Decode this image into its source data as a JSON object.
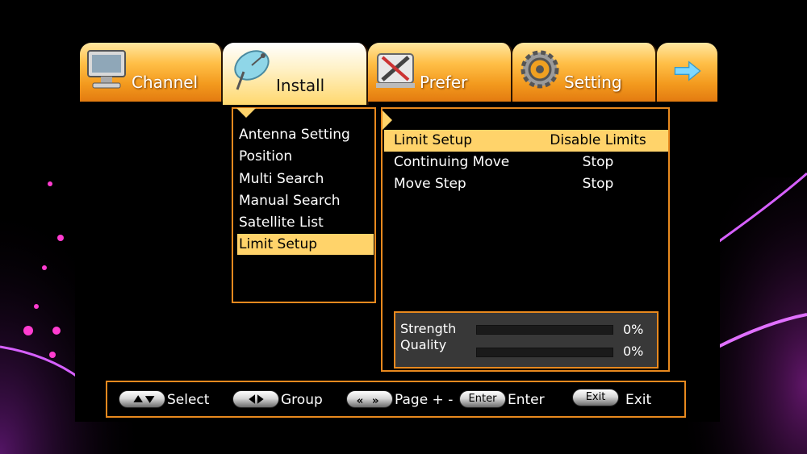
{
  "tabs": [
    {
      "label": "Channel",
      "icon": "monitor-icon"
    },
    {
      "label": "Install",
      "icon": "satellite-dish-icon",
      "active": true
    },
    {
      "label": "Prefer",
      "icon": "tools-icon"
    },
    {
      "label": "Setting",
      "icon": "gear-icon"
    },
    {
      "label": "",
      "icon": "arrow-right-icon"
    }
  ],
  "submenu": {
    "items": [
      {
        "label": "Antenna Setting"
      },
      {
        "label": "Position"
      },
      {
        "label": "Multi Search"
      },
      {
        "label": "Manual Search"
      },
      {
        "label": "Satellite List"
      },
      {
        "label": "Limit Setup",
        "selected": true
      }
    ]
  },
  "settings": {
    "rows": [
      {
        "name": "Limit Setup",
        "value": "Disable Limits",
        "selected": true
      },
      {
        "name": "Continuing Move",
        "value": "Stop"
      },
      {
        "name": "Move Step",
        "value": "Stop"
      }
    ]
  },
  "signal": {
    "strength_label": "Strength",
    "strength_value": "0%",
    "strength_level": 0,
    "quality_label": "Quality",
    "quality_value": "0%",
    "quality_level": 0
  },
  "help": {
    "select_label": "Select",
    "group_label": "Group",
    "page_label": "Page + -",
    "enter_key": "Enter",
    "enter_label": "Enter",
    "exit_key": "Exit",
    "exit_label": "Exit"
  },
  "colors": {
    "accent": "#e8891e",
    "highlight": "#ffd36a"
  }
}
